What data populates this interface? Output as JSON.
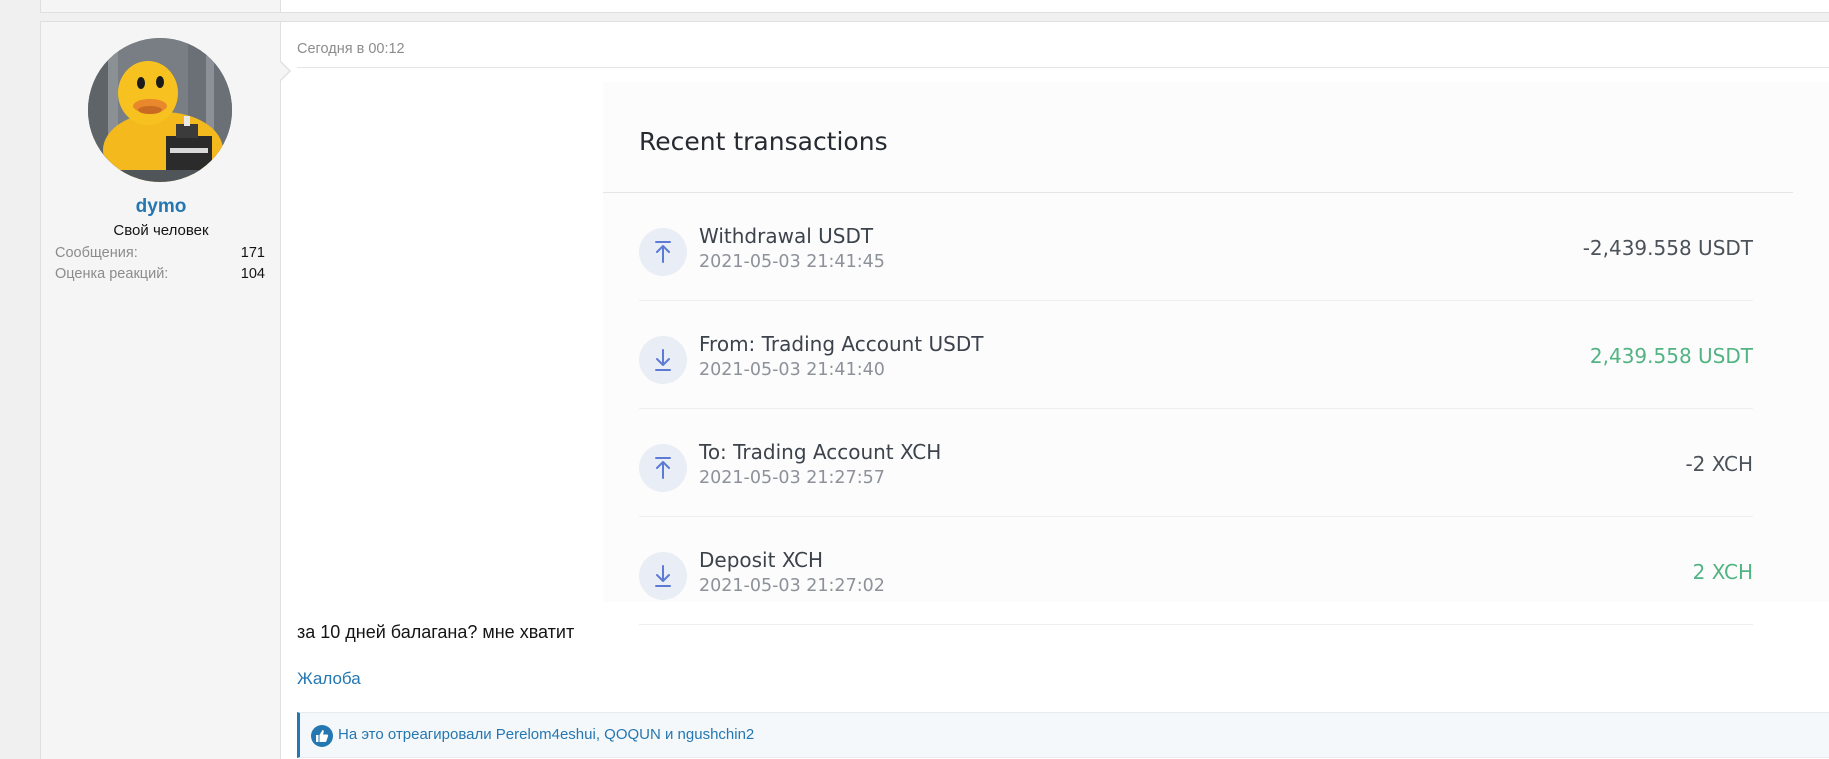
{
  "post": {
    "date": "Сегодня в 00:12",
    "text": "за 10 дней балагана? мне хватит",
    "report_label": "Жалоба",
    "reactions_text": "На это отреагировали Perelom4eshui, QOQUN и ngushchin2"
  },
  "user": {
    "name": "dymo",
    "title": "Свой человек",
    "stats": [
      {
        "label": "Сообщения:",
        "value": "171"
      },
      {
        "label": "Оценка реакций:",
        "value": "104"
      }
    ]
  },
  "screenshot": {
    "title": "Recent transactions",
    "transactions": [
      {
        "name": "Withdrawal USDT",
        "time": "2021-05-03 21:41:45",
        "amount": "-2,439.558 USDT",
        "direction": "out"
      },
      {
        "name": "From: Trading Account USDT",
        "time": "2021-05-03 21:41:40",
        "amount": "2,439.558 USDT",
        "direction": "in"
      },
      {
        "name": "To: Trading Account XCH",
        "time": "2021-05-03 21:27:57",
        "amount": "-2 XCH",
        "direction": "out"
      },
      {
        "name": "Deposit XCH",
        "time": "2021-05-03 21:27:02",
        "amount": "2 XCH",
        "direction": "in"
      }
    ]
  },
  "colors": {
    "link": "#2577b1",
    "positive_amount": "#52b383",
    "negative_amount": "#4c525a",
    "icon_blue": "#5b7bd5"
  }
}
